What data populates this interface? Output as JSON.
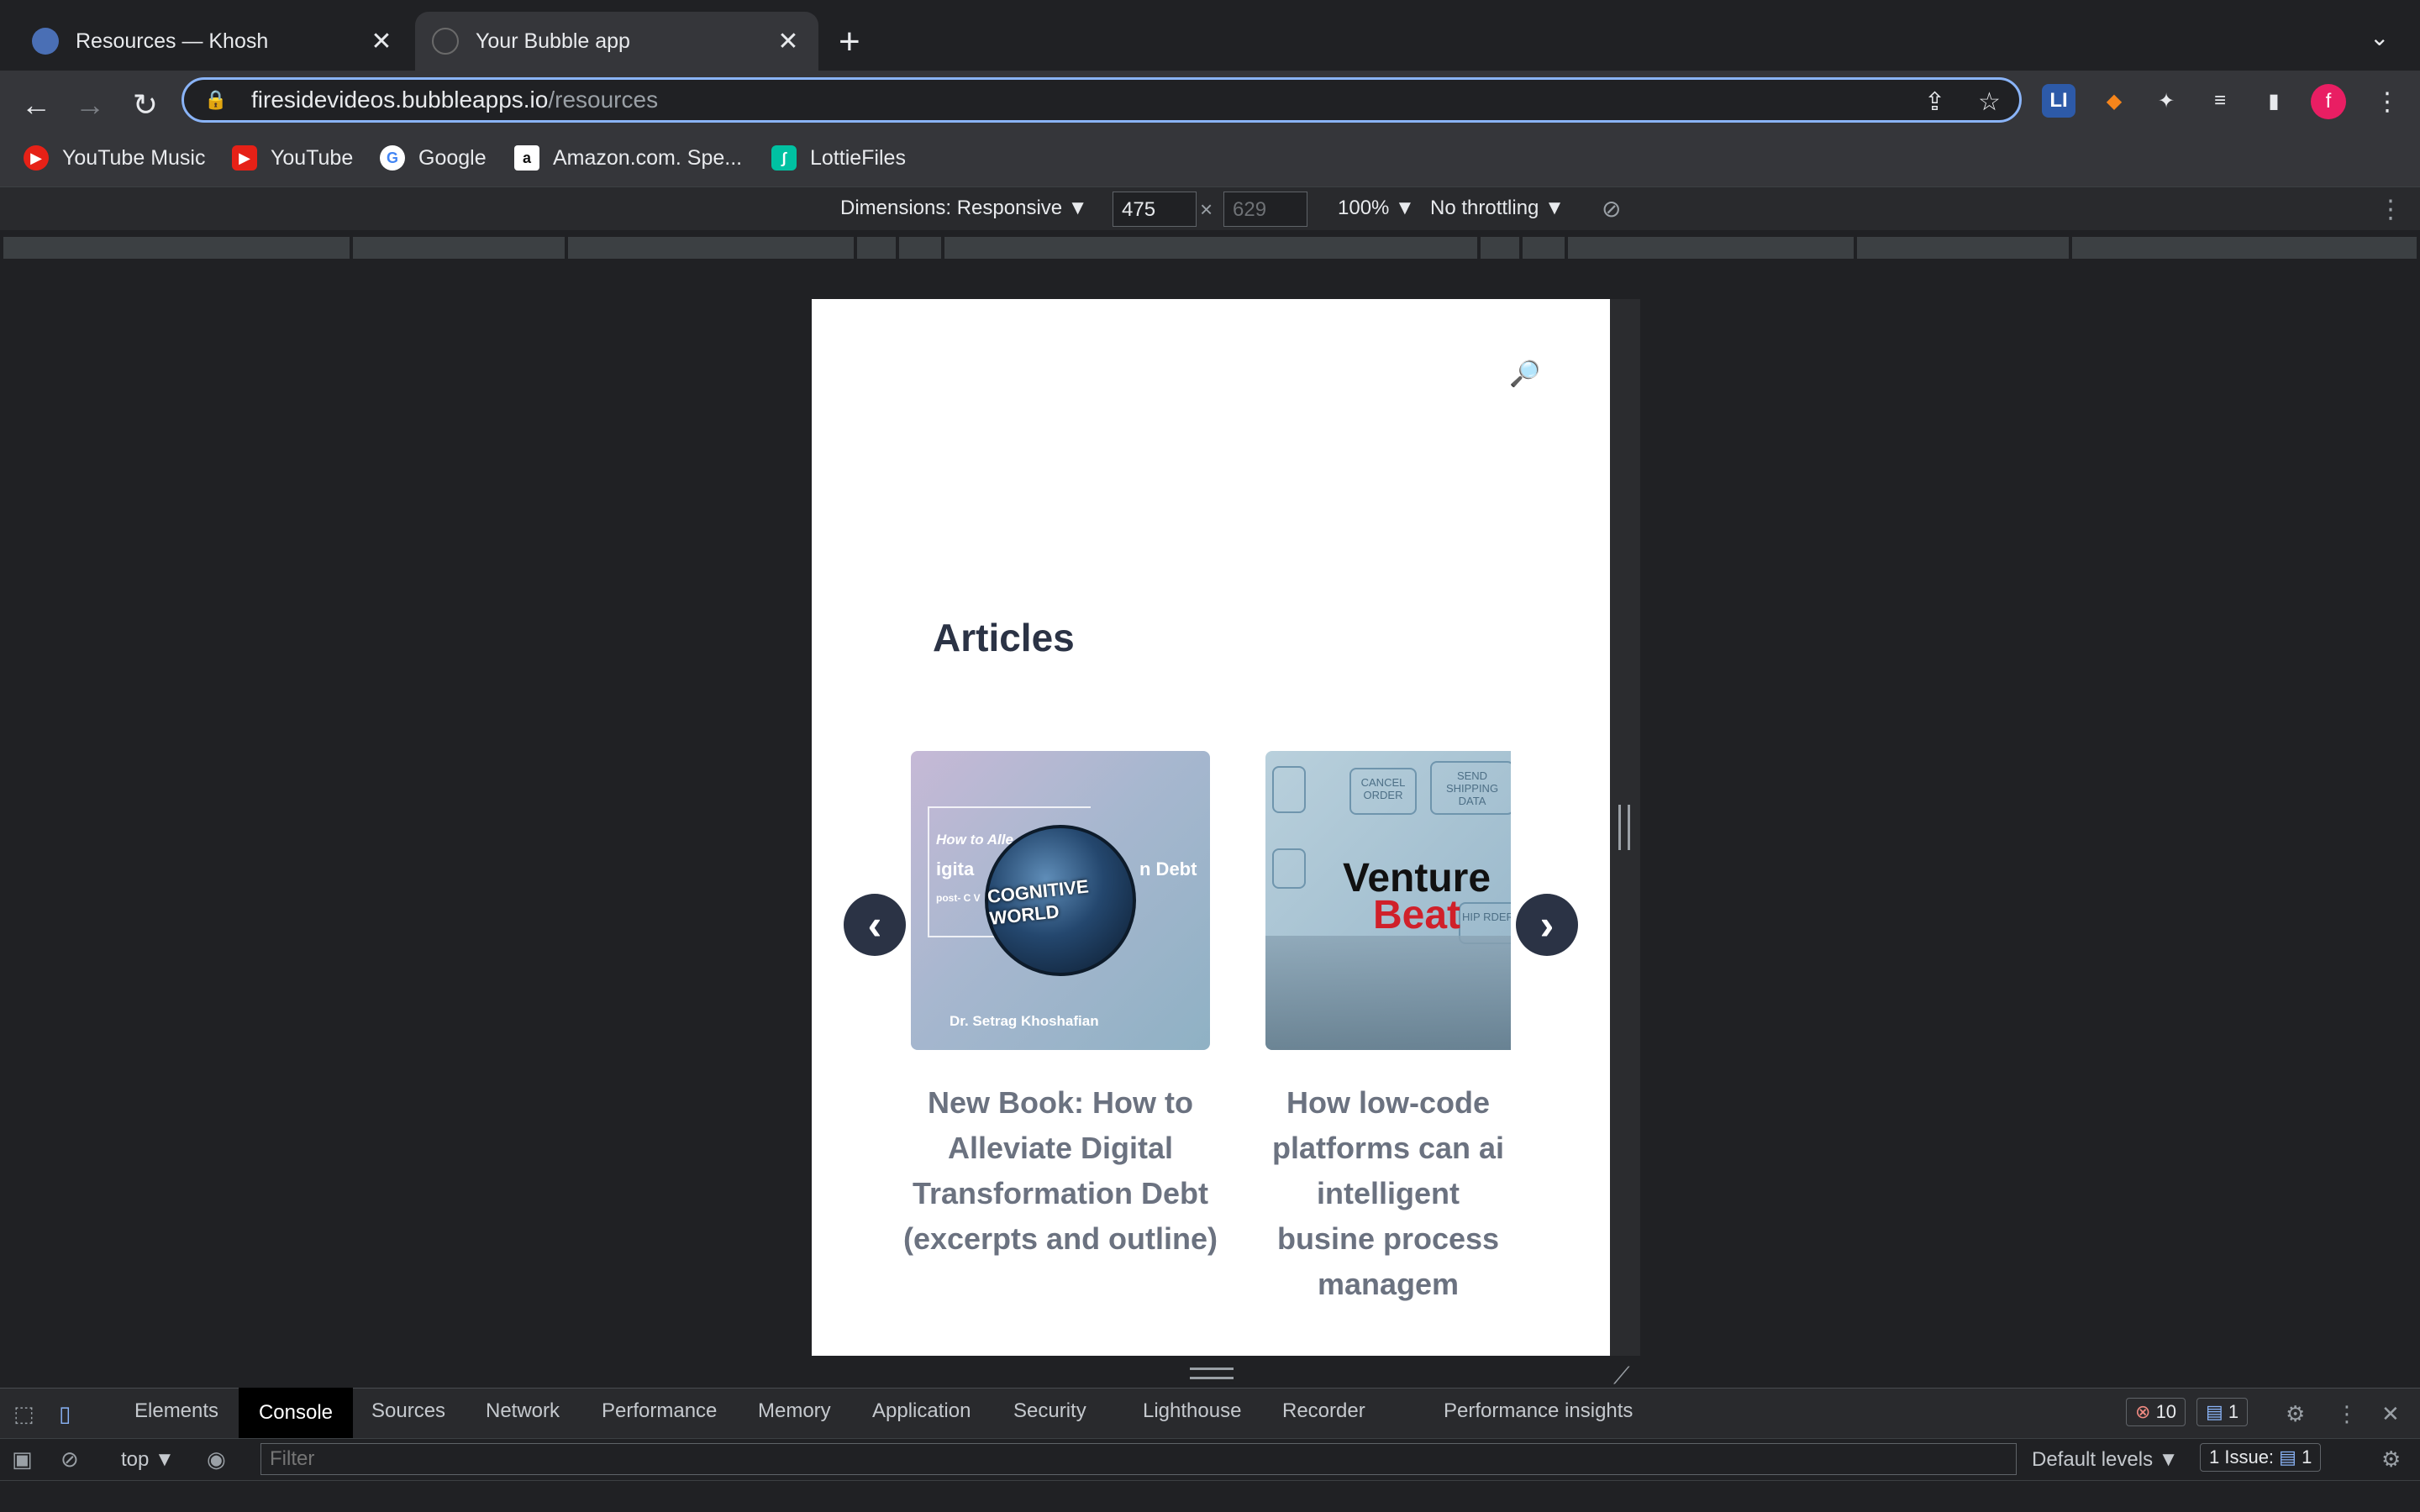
{
  "tabs": [
    {
      "title": "Resources — Khosh",
      "active": false
    },
    {
      "title": "Your Bubble app",
      "active": true
    }
  ],
  "tab_close_glyph": "✕",
  "new_tab_glyph": "+",
  "omnibox": {
    "host": "firesidevideos.bubbleapps.io",
    "path": "/resources"
  },
  "extensions": {
    "li_label": "LI",
    "profile_initial": "f"
  },
  "bookmarks": [
    "YouTube Music",
    "YouTube",
    "Google",
    "Amazon.com. Spe...",
    "LottieFiles"
  ],
  "device_toolbar": {
    "dimensions_label": "Dimensions: Responsive ▼",
    "width": "475",
    "height": "629",
    "times": "×",
    "zoom": "100% ▼",
    "throttling": "No throttling ▼"
  },
  "page": {
    "heading": "Articles",
    "articles": [
      {
        "title": "New Book: How to Alleviate Digital Transformation Debt (excerpts and outline)",
        "image_texts": {
          "badge": "COGNITIVE WORLD",
          "line1": "How to Alle",
          "line2": "igita",
          "line2b": "n Debt",
          "line3": "post- C V",
          "author": "Dr. Setrag Khoshafian"
        }
      },
      {
        "title": "How low-code platforms can ai intelligent busine process managem",
        "image_texts": {
          "brand1": "Venture",
          "brand2": "Beat",
          "box1": "CANCEL ORDER",
          "box2": "SEND SHIPPING DATA",
          "box3": "HIP RDER"
        }
      }
    ]
  },
  "devtools": {
    "tabs": [
      "Elements",
      "Console",
      "Sources",
      "Network",
      "Performance",
      "Memory",
      "Application",
      "Security",
      "Lighthouse",
      "Recorder",
      "Performance insights"
    ],
    "errors": "10",
    "messages": "1",
    "context": "top ▼",
    "filter_placeholder": "Filter",
    "levels": "Default levels ▼",
    "issues": "1 Issue:",
    "issues_count": "1"
  },
  "colors": {
    "accent": "#8ab4f8",
    "heading": "#2b3345",
    "error": "#f28b82"
  }
}
